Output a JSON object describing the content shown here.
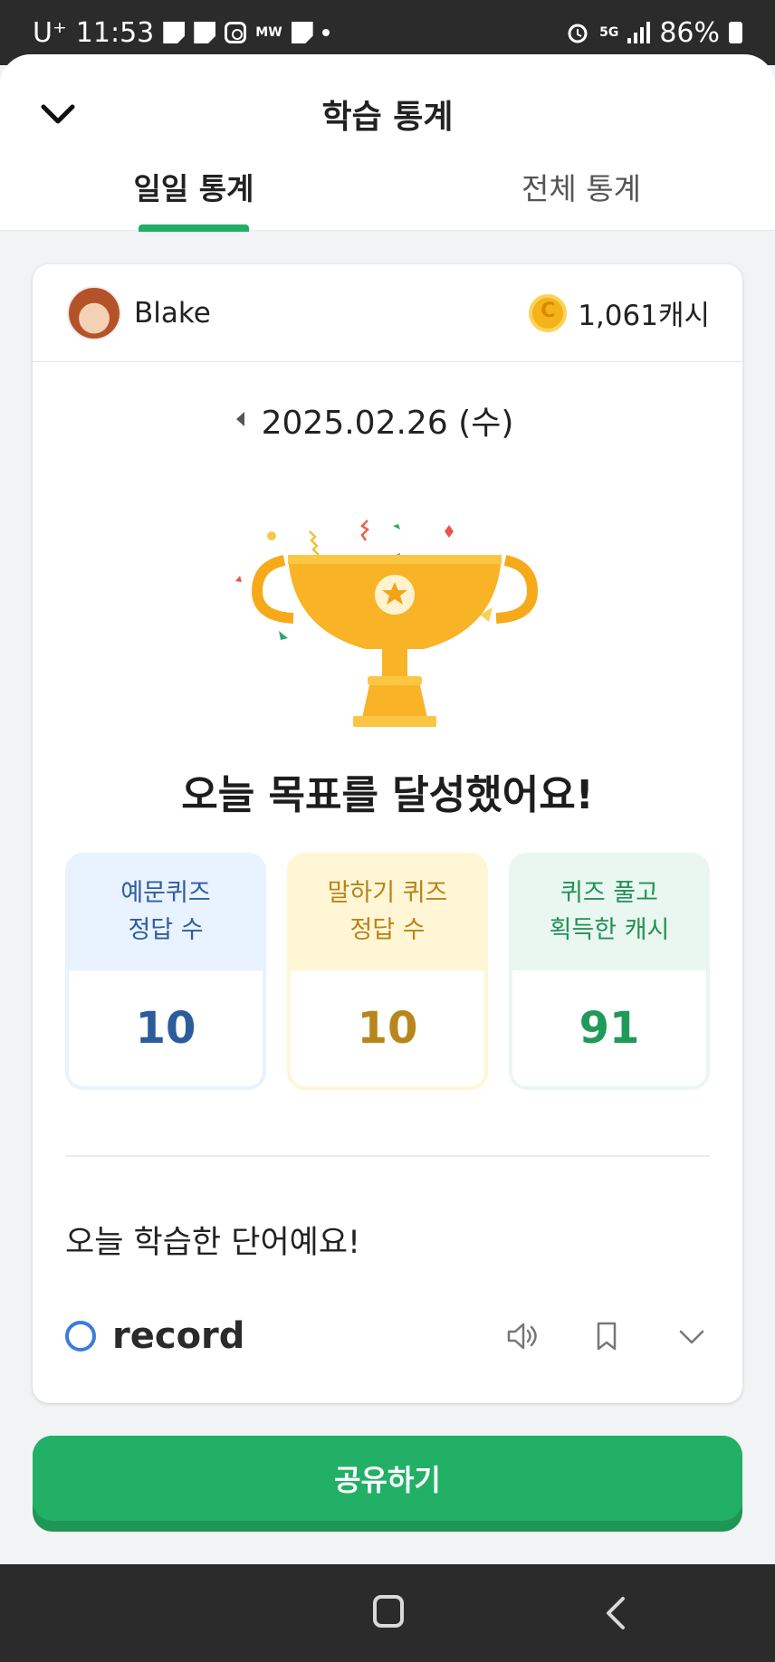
{
  "status_bar": {
    "carrier": "U⁺",
    "time": "11:53",
    "app_small": "MW",
    "network": "5G",
    "battery": "86%"
  },
  "header": {
    "title": "학습 통계"
  },
  "tabs": [
    {
      "label": "일일 통계",
      "active": true
    },
    {
      "label": "전체 통계",
      "active": false
    }
  ],
  "profile": {
    "name": "Blake",
    "cash": "1,061캐시"
  },
  "date": "2025.02.26 (수)",
  "goal_message": "오늘 목표를 달성했어요!",
  "stats": [
    {
      "label": "예문퀴즈\n정답 수",
      "value": "10",
      "color": "#2c5c9c"
    },
    {
      "label": "말하기 퀴즈\n정답 수",
      "value": "10",
      "color": "#b8861c"
    },
    {
      "label": "퀴즈 풀고\n획득한 캐시",
      "value": "91",
      "color": "#1f9a58"
    }
  ],
  "learned_heading": "오늘 학습한 단어예요!",
  "word": {
    "text": "record"
  },
  "share_button": "공유하기",
  "colors": {
    "accent": "#22b067",
    "tab_indicator": "#1fae63"
  },
  "icons": [
    "back-chevron-icon",
    "coin-icon",
    "trophy-icon",
    "speaker-icon",
    "bookmark-icon",
    "expand-chevron-icon",
    "home-nav-icon",
    "back-nav-icon"
  ]
}
